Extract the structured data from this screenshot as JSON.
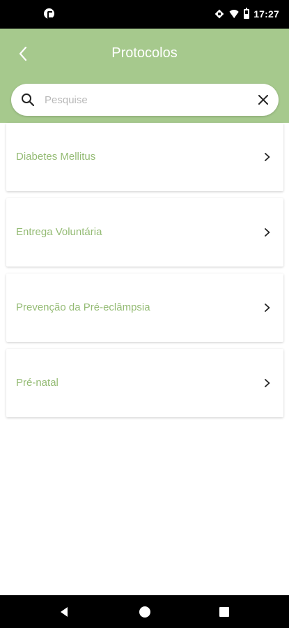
{
  "status_bar": {
    "time": "17:27",
    "icons": [
      "notification-icon",
      "data-saver-icon",
      "wifi-icon",
      "battery-icon"
    ]
  },
  "header": {
    "title": "Protocolos",
    "back_icon": "arrow-back-icon",
    "background_color": "#a6c98d"
  },
  "search": {
    "placeholder": "Pesquise",
    "value": "",
    "search_icon": "search-icon",
    "clear_icon": "close-icon"
  },
  "protocols": {
    "items": [
      {
        "label": "Diabetes Mellitus"
      },
      {
        "label": "Entrega Voluntária"
      },
      {
        "label": "Prevenção da Pré-eclâmpsia"
      },
      {
        "label": "Pré-natal"
      }
    ],
    "item_icon": "chevron-right-icon",
    "label_color": "#94bb74"
  },
  "nav_bar": {
    "buttons": [
      "back-triangle-icon",
      "home-circle-icon",
      "recents-square-icon"
    ]
  }
}
